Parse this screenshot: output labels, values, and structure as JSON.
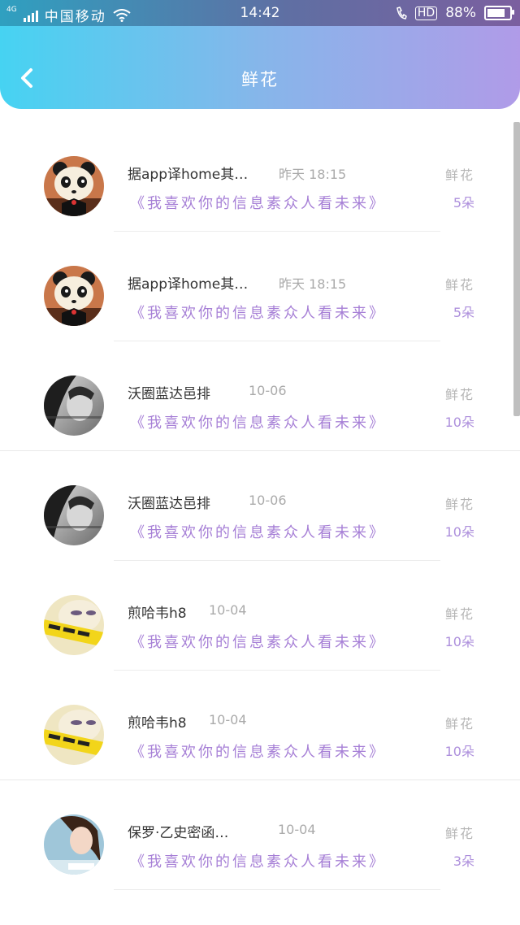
{
  "status_bar": {
    "network": "4G",
    "carrier": "中国移动",
    "time": "14:42",
    "hd": "HD",
    "battery": "88%",
    "battery_level": 0.88
  },
  "header": {
    "title": "鲜花",
    "back_icon": "chevron-left-icon"
  },
  "colors": {
    "header_gradient": [
      "#46d3f2",
      "#b09be8"
    ],
    "message": "#a67fd6",
    "count": "#ad8fdc"
  },
  "rows": [
    {
      "name": "据app译home其…",
      "time": "昨天 18:15",
      "message": "《我喜欢你的信息素众人看未来》",
      "gift_label": "鲜花",
      "count": "5朵",
      "avatar": "panda-avatar"
    },
    {
      "name": "据app译home其…",
      "time": "昨天 18:15",
      "message": "《我喜欢你的信息素众人看未来》",
      "gift_label": "鲜花",
      "count": "5朵",
      "avatar": "panda-avatar"
    },
    {
      "name": "沃圈蓝达邑排",
      "time": "10-06",
      "message": "《我喜欢你的信息素众人看未来》",
      "gift_label": "鲜花",
      "count": "10朵",
      "avatar": "bw-photo-avatar"
    },
    {
      "name": "沃圈蓝达邑排",
      "time": "10-06",
      "message": "《我喜欢你的信息素众人看未来》",
      "gift_label": "鲜花",
      "count": "10朵",
      "avatar": "bw-photo-avatar"
    },
    {
      "name": "煎哈韦h8",
      "time": "10-04",
      "message": "《我喜欢你的信息素众人看未来》",
      "gift_label": "鲜花",
      "count": "10朵",
      "avatar": "yellow-photo-avatar"
    },
    {
      "name": "煎哈韦h8",
      "time": "10-04",
      "message": "《我喜欢你的信息素众人看未来》",
      "gift_label": "鲜花",
      "count": "10朵",
      "avatar": "yellow-photo-avatar"
    },
    {
      "name": "保罗·乙史密函…",
      "time": "10-04",
      "message": "《我喜欢你的信息素众人看未来》",
      "gift_label": "鲜花",
      "count": "3朵",
      "avatar": "girl-photo-avatar"
    }
  ]
}
